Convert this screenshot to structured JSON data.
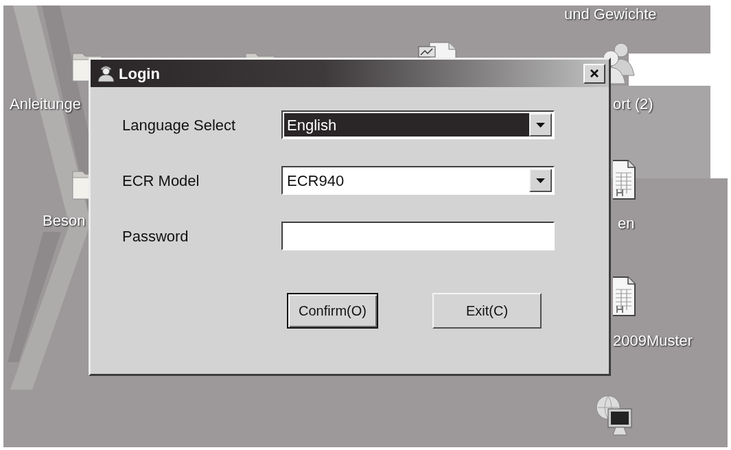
{
  "desktop": {
    "items": [
      {
        "kind": "folder",
        "label": "Anleitunge"
      },
      {
        "kind": "folder",
        "label": "Beson"
      },
      {
        "kind": "folder"
      },
      {
        "kind": "chart-document"
      },
      {
        "kind": "text",
        "label": "und Gewichte"
      },
      {
        "kind": "users",
        "label": "ort (2)"
      },
      {
        "kind": "spreadsheet",
        "label": "en"
      },
      {
        "kind": "spreadsheet",
        "label": "2009Muster"
      },
      {
        "kind": "network"
      }
    ]
  },
  "dialog": {
    "title": "Login",
    "fields": [
      {
        "kind": "select",
        "label": "Language Select",
        "value": "English",
        "focused": true
      },
      {
        "kind": "select",
        "label": "ECR Model",
        "value": "ECR940",
        "focused": false
      },
      {
        "kind": "password",
        "label": "Password"
      }
    ],
    "buttons": [
      {
        "label": "Confirm(O)",
        "default": true
      },
      {
        "label": "Exit(C)",
        "default": false
      }
    ]
  }
}
